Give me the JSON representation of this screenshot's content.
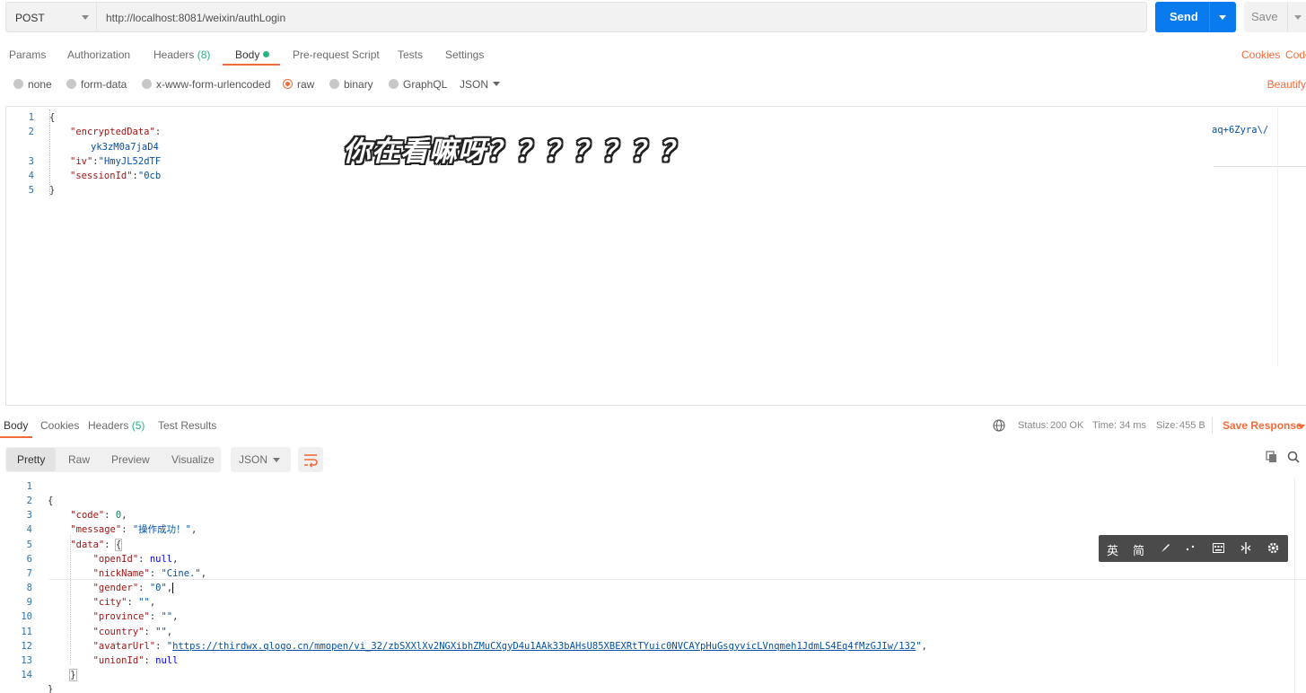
{
  "request": {
    "method": "POST",
    "url": "http://localhost:8081/weixin/authLogin",
    "send_label": "Send",
    "save_label": "Save"
  },
  "request_tabs": {
    "params": "Params",
    "authorization": "Authorization",
    "headers": "Headers",
    "headers_count": "(8)",
    "body": "Body",
    "prerequest": "Pre-request Script",
    "tests": "Tests",
    "settings": "Settings",
    "cookies": "Cookies",
    "code": "Code"
  },
  "body_types": {
    "none": "none",
    "form_data": "form-data",
    "urlencoded": "x-www-form-urlencoded",
    "raw": "raw",
    "binary": "binary",
    "graphql": "GraphQL",
    "format": "JSON",
    "beautify": "Beautify"
  },
  "request_body": {
    "line_numbers": [
      "1",
      "2",
      "",
      "3",
      "4",
      "5"
    ],
    "l1": "{",
    "l2_key": "\"encryptedData\"",
    "l2_colon": ":",
    "l2_cont": "yk3zM0a7jaD4",
    "l2_right": "aq+6Zyra\\/",
    "l3_key": "\"iv\"",
    "l3_val": "\"HmyJL52dTF",
    "l4_key": "\"sessionId\"",
    "l4_val": "\"0cb",
    "l5": "}"
  },
  "overlay_text": "你在看嘛呀？？？？？？？",
  "response_tabs": {
    "body": "Body",
    "cookies": "Cookies",
    "headers": "Headers",
    "headers_count": "(5)",
    "test_results": "Test Results"
  },
  "response_status": {
    "status_label": "Status:",
    "status_value": "200 OK",
    "time_label": "Time:",
    "time_value": "34 ms",
    "size_label": "Size:",
    "size_value": "455 B",
    "save_response": "Save Response"
  },
  "response_view": {
    "pretty": "Pretty",
    "raw": "Raw",
    "preview": "Preview",
    "visualize": "Visualize",
    "format": "JSON"
  },
  "response_body": {
    "line_numbers": [
      "1",
      "2",
      "3",
      "4",
      "5",
      "6",
      "7",
      "8",
      "9",
      "10",
      "11",
      "12",
      "13",
      "14"
    ],
    "l1": "{",
    "l2_key": "\"code\"",
    "l2_val": "0",
    "l3_key": "\"message\"",
    "l3_val": "\"操作成功！\"",
    "l4_key": "\"data\"",
    "l4_val": "{",
    "l5_key": "\"openId\"",
    "l5_val": "null",
    "l6_key": "\"nickName\"",
    "l6_val": "\"Cine.\"",
    "l7_key": "\"gender\"",
    "l7_val": "\"0\"",
    "l8_key": "\"city\"",
    "l8_val": "\"\"",
    "l9_key": "\"province\"",
    "l9_val": "\"\"",
    "l10_key": "\"country\"",
    "l10_val": "\"\"",
    "l11_key": "\"avatarUrl\"",
    "l11_quote": "\"",
    "l11_link": "https://thirdwx.qlogo.cn/mmopen/vi_32/zbSXXlXv2NGXibhZMuCXgyD4u1AAk33bAHsU85XBEXRtTYuic0NVCAYpHuGsgyvicLVnqmeh1JdmLS4Eq4fMzGJIw/132",
    "l12_key": "\"unionId\"",
    "l12_val": "null",
    "l13": "}",
    "l14": "}"
  },
  "ime_toolbar": {
    "lang": "英",
    "script": "简"
  },
  "colors": {
    "accent": "#f26b3a",
    "send": "#097bed",
    "status_ok": "#26b47f"
  }
}
